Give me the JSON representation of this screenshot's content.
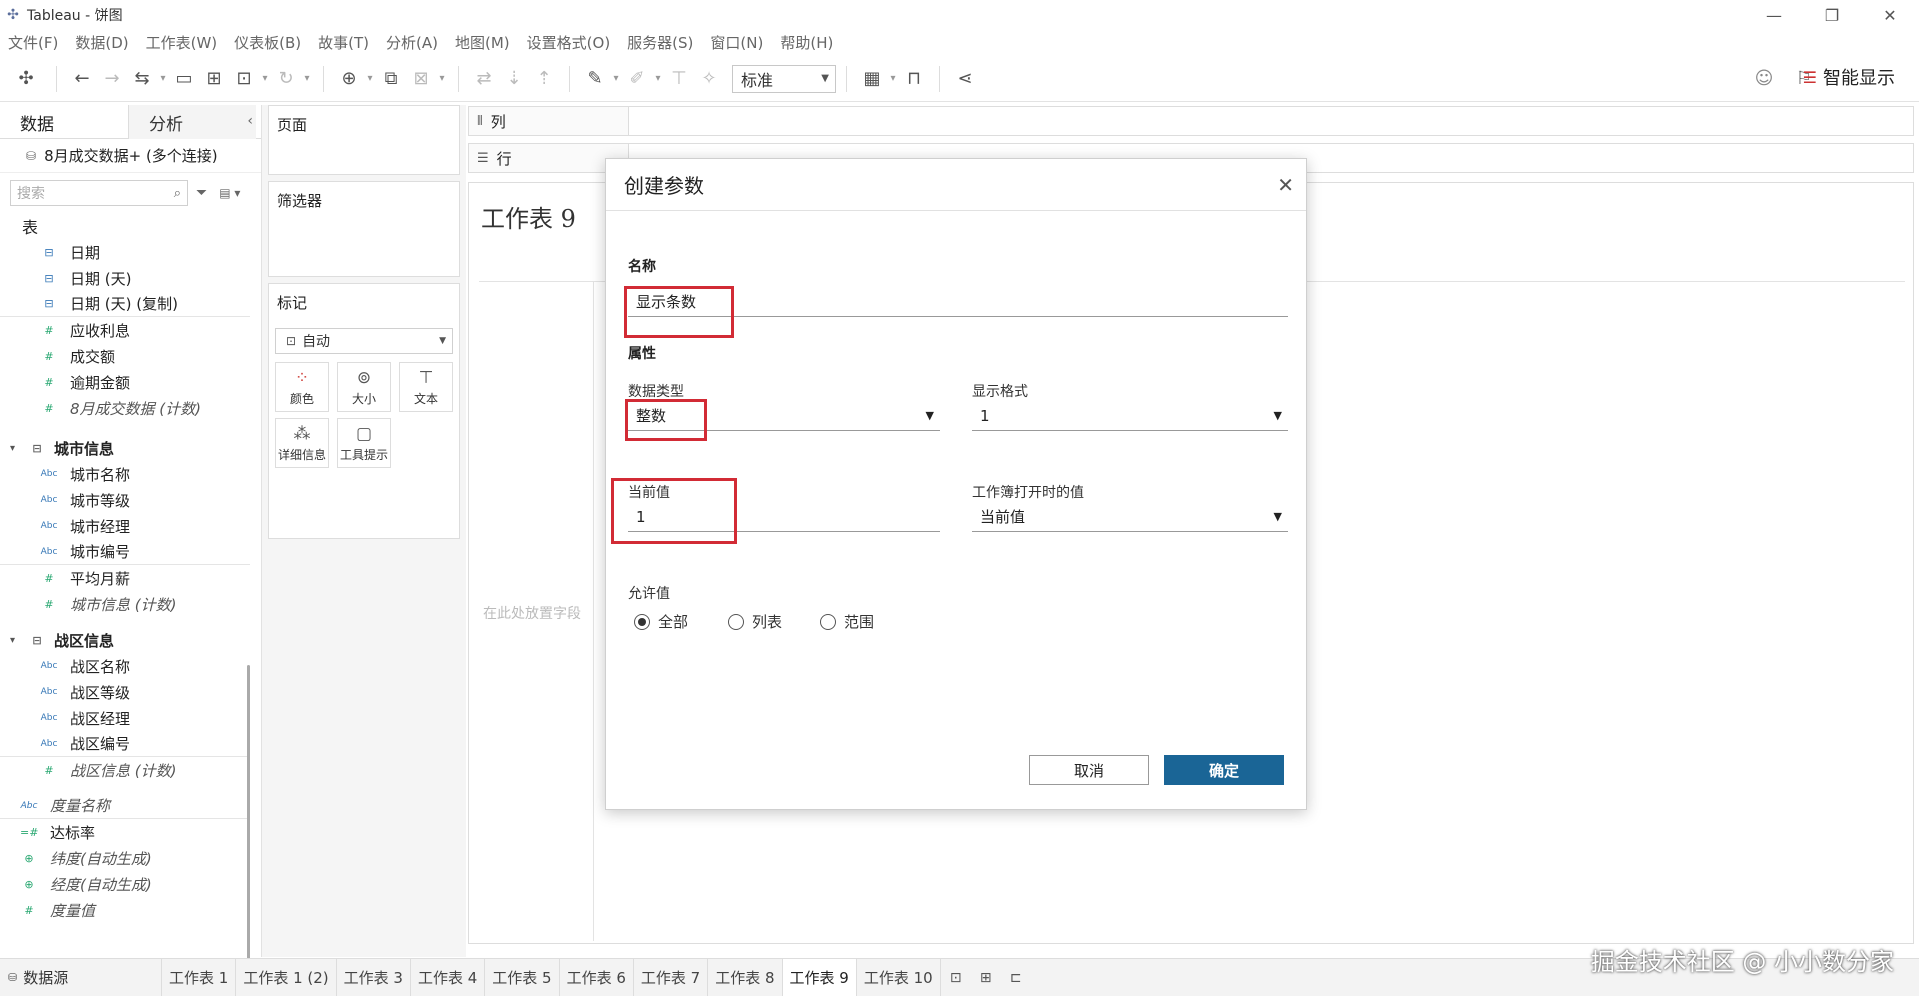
{
  "window": {
    "title": "Tableau - 饼图",
    "minimize": "—",
    "restore": "❐",
    "close": "✕"
  },
  "menu": [
    "文件(F)",
    "数据(D)",
    "工作表(W)",
    "仪表板(B)",
    "故事(T)",
    "分析(A)",
    "地图(M)",
    "设置格式(O)",
    "服务器(S)",
    "窗口(N)",
    "帮助(H)"
  ],
  "toolbar": {
    "fit_select": "标准",
    "smart_show": "智能显示"
  },
  "data_pane": {
    "tabs": [
      "数据",
      "分析"
    ],
    "connection": "8月成交数据+ (多个连接)",
    "search_placeholder": "搜索",
    "section": "表",
    "fields_top": [
      {
        "icon": "⊟",
        "type": "date",
        "label": "日期",
        "italic": false
      },
      {
        "icon": "⊟",
        "type": "date",
        "label": "日期 (天)",
        "italic": false
      },
      {
        "icon": "⊟",
        "type": "date",
        "label": "日期 (天) (复制)",
        "italic": false
      },
      {
        "icon": "#",
        "type": "num",
        "label": "应收利息",
        "italic": false
      },
      {
        "icon": "#",
        "type": "num",
        "label": "成交额",
        "italic": false
      },
      {
        "icon": "#",
        "type": "num",
        "label": "逾期金额",
        "italic": false
      },
      {
        "icon": "#",
        "type": "num",
        "label": "8月成交数据 (计数)",
        "italic": true
      }
    ],
    "group_city": {
      "name": "城市信息",
      "fields": [
        {
          "icon": "Abc",
          "type": "abc",
          "label": "城市名称",
          "italic": false
        },
        {
          "icon": "Abc",
          "type": "abc",
          "label": "城市等级",
          "italic": false
        },
        {
          "icon": "Abc",
          "type": "abc",
          "label": "城市经理",
          "italic": false
        },
        {
          "icon": "Abc",
          "type": "abc",
          "label": "城市编号",
          "italic": false
        },
        {
          "icon": "#",
          "type": "num",
          "label": "平均月薪",
          "italic": false
        },
        {
          "icon": "#",
          "type": "num",
          "label": "城市信息 (计数)",
          "italic": true
        }
      ]
    },
    "group_zone": {
      "name": "战区信息",
      "fields": [
        {
          "icon": "Abc",
          "type": "abc",
          "label": "战区名称",
          "italic": false
        },
        {
          "icon": "Abc",
          "type": "abc",
          "label": "战区等级",
          "italic": false
        },
        {
          "icon": "Abc",
          "type": "abc",
          "label": "战区经理",
          "italic": false
        },
        {
          "icon": "Abc",
          "type": "abc",
          "label": "战区编号",
          "italic": false
        },
        {
          "icon": "#",
          "type": "num",
          "label": "战区信息 (计数)",
          "italic": true
        }
      ]
    },
    "fields_bottom": [
      {
        "icon": "Abc",
        "type": "abc",
        "label": "度量名称",
        "italic": true
      },
      {
        "icon": "=#",
        "type": "num",
        "label": "达标率",
        "italic": false
      },
      {
        "icon": "⊕",
        "type": "geo",
        "label": "纬度(自动生成)",
        "italic": true
      },
      {
        "icon": "⊕",
        "type": "geo",
        "label": "经度(自动生成)",
        "italic": true
      },
      {
        "icon": "#",
        "type": "num",
        "label": "度量值",
        "italic": true
      }
    ]
  },
  "shelves": {
    "pages": "页面",
    "filters": "筛选器",
    "marks": "标记",
    "marks_type": "自动",
    "mark_buttons": [
      "颜色",
      "大小",
      "文本",
      "详细信息",
      "工具提示"
    ],
    "columns": "列",
    "rows": "行"
  },
  "worksheet": {
    "title": "工作表 9",
    "drop_hint": "在此处放置字段"
  },
  "dialog": {
    "title": "创建参数",
    "name_label": "名称",
    "name_value": "显示条数",
    "properties_label": "属性",
    "data_type_label": "数据类型",
    "data_type_value": "整数",
    "display_format_label": "显示格式",
    "display_format_value": "1",
    "current_value_label": "当前值",
    "current_value": "1",
    "workbook_open_label": "工作簿打开时的值",
    "workbook_open_value": "当前值",
    "allowable_label": "允许值",
    "allowable_options": [
      "全部",
      "列表",
      "范围"
    ],
    "allowable_selected": "全部",
    "cancel": "取消",
    "ok": "确定"
  },
  "bottom": {
    "datasource": "数据源",
    "sheets": [
      "工作表 1",
      "工作表 1 (2)",
      "工作表 3",
      "工作表 4",
      "工作表 5",
      "工作表 6",
      "工作表 7",
      "工作表 8",
      "工作表 9",
      "工作表 10"
    ],
    "active_sheet": "工作表 9"
  },
  "watermark": "掘金技术社区 @ 小小数分家",
  "colors": {
    "ok_button": "#1a6596",
    "highlight_box": "#d22b35",
    "dimension_icon": "#3677b6",
    "measure_icon": "#2aa872"
  }
}
